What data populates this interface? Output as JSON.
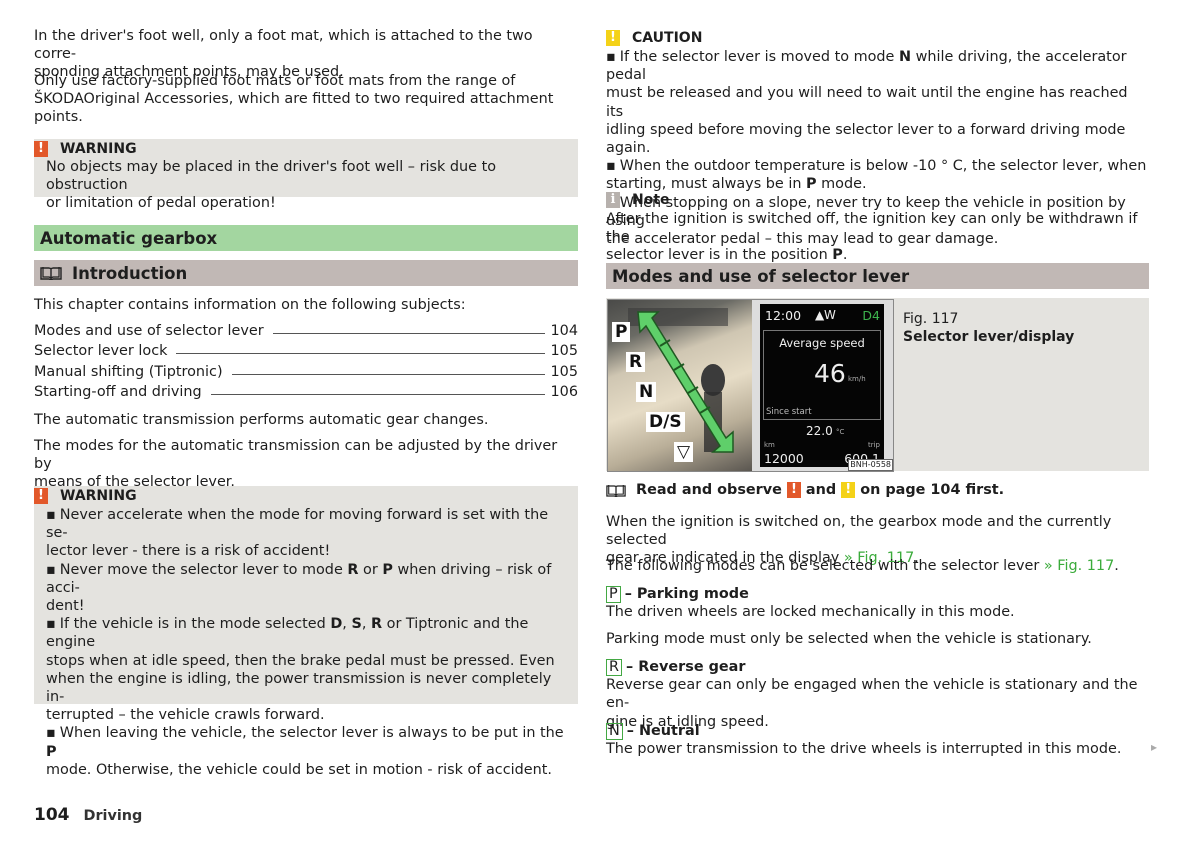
{
  "left": {
    "intro_p1": "In the driver's foot well, only a foot mat, which is attached to the two corre-sponding attachment points, may be used.",
    "intro_p1_l1": "In the driver's foot well, only a foot mat, which is attached to the two corre-",
    "intro_p1_l2": "sponding attachment points, may be used.",
    "intro_p2_l1": "Only use factory-supplied foot mats or foot mats from the range of",
    "intro_p2_l2": "ŠKODAOriginal Accessories, which are fitted to two required attachment",
    "intro_p2_l3": "points.",
    "warning1": {
      "icon": "!",
      "title": "WARNING",
      "l1": "No objects may be placed in the driver's foot well – risk due to obstruction",
      "l2": "or limitation of pedal operation!"
    },
    "section_title": "Automatic gearbox",
    "subsection_icon": "book-icon",
    "subsection_title": "Introduction",
    "toc_intro": "This chapter contains information on the following subjects:",
    "toc": [
      {
        "label": "Modes and use of selector lever",
        "page": "104"
      },
      {
        "label": "Selector lever lock",
        "page": "105"
      },
      {
        "label": "Manual shifting (Tiptronic)",
        "page": "105"
      },
      {
        "label": "Starting-off and driving",
        "page": "106"
      }
    ],
    "para1": "The automatic transmission performs automatic gear changes.",
    "para2_l1": "The modes for the automatic transmission can be adjusted by the driver by",
    "para2_l2": "means of the selector lever.",
    "warning2": {
      "icon": "!",
      "title": "WARNING",
      "b1_l1": "Never accelerate when the mode for moving forward is set with the se-",
      "b1_l2": "lector lever - there is a risk of accident!",
      "b2_l1a": "Never move the selector lever to mode ",
      "b2_R": "R",
      "b2_or": " or ",
      "b2_P": "P",
      "b2_l1b": " when driving – risk of acci-",
      "b2_l2": "dent!",
      "b3_l1a": "If the vehicle is in the mode selected ",
      "b3_D": "D",
      "b3_S": "S",
      "b3_R": "R",
      "b3_l1b": " or Tiptronic and the engine",
      "b3_l2": "stops when at idle speed, then the brake pedal must be pressed. Even",
      "b3_l3": "when the engine is idling, the power transmission is never completely in-",
      "b3_l4": "terrupted – the vehicle crawls forward.",
      "b4_l1a": "When leaving the vehicle, the selector lever is always to be put in the ",
      "b4_P": "P",
      "b4_l2": "mode. Otherwise, the vehicle could be set in motion - risk of accident."
    }
  },
  "right": {
    "caution": {
      "icon": "!",
      "title": "CAUTION",
      "b1_l1a": "If the selector lever is moved to mode ",
      "b1_N": "N",
      "b1_l1b": " while driving, the accelerator pedal",
      "b1_l2": "must be released and you will need to wait until the engine has reached its",
      "b1_l3": "idling speed before moving the selector lever to a forward driving mode again.",
      "b2_l1": "When the outdoor temperature is below -10 ° C, the selector lever, when",
      "b2_l2a": "starting, must always be in ",
      "b2_P": "P",
      "b2_l2b": " mode.",
      "b3_l1": "When stopping on a slope, never try to keep the vehicle in position by using",
      "b3_l2": "the accelerator pedal – this may lead to gear damage."
    },
    "note": {
      "icon": "i",
      "title": "Note",
      "l1": "After the ignition is switched off, the ignition key can only be withdrawn if the",
      "l2a": "selector lever is in the position ",
      "l2_P": "P",
      "l2b": "."
    },
    "section_title": "Modes and use of selector lever",
    "figure": {
      "gears": [
        "P",
        "R",
        "N",
        "D/S",
        "▽"
      ],
      "display": {
        "time": "12:00",
        "compass": "W",
        "gear": "D4",
        "title": "Average speed",
        "value": "46",
        "unit": "km/h",
        "since": "Since start",
        "temp": "22.0",
        "temp_unit": "°C",
        "km_label": "km",
        "trip_label": "trip",
        "odometer": "12000",
        "trip": "600.1"
      },
      "code": "BNH-0558",
      "number": "Fig. 117",
      "caption": "Selector lever/display"
    },
    "read_observe": {
      "a": "Read and observe ",
      "and": " and ",
      "b": " on page 104 first."
    },
    "para1_l1": "When the ignition is switched on, the gearbox mode and the currently selected",
    "para1_l2a": "gear are indicated in the display ",
    "para1_link": "» Fig. 117",
    "para1_end": ".",
    "para2a": "The following modes can be selected with the selector lever ",
    "para2_link": "» Fig. 117",
    "para2_end": ".",
    "modes": [
      {
        "key": "P",
        "title": "– Parking mode",
        "lines": [
          "The driven wheels are locked mechanically in this mode."
        ],
        "extra": "Parking mode must only be selected when the vehicle is stationary."
      },
      {
        "key": "R",
        "title": "– Reverse gear",
        "lines": [
          "Reverse gear can only be engaged when the vehicle is stationary and the en-",
          "gine is at idling speed."
        ]
      },
      {
        "key": "N",
        "title": "– Neutral",
        "lines": [
          "The power transmission to the drive wheels is interrupted in this mode."
        ]
      }
    ],
    "continue_icon": "▸"
  },
  "footer": {
    "page": "104",
    "section": "Driving"
  }
}
